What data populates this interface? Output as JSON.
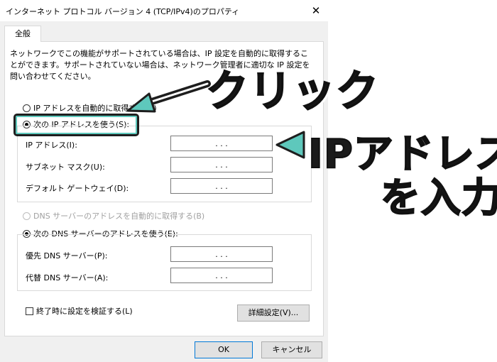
{
  "window": {
    "title": "インターネット プロトコル バージョン 4 (TCP/IPv4)のプロパティ",
    "close_glyph": "✕"
  },
  "tabs": [
    {
      "label": "全般"
    }
  ],
  "description": "ネットワークでこの機能がサポートされている場合は、IP 設定を自動的に取得することができます。サポートされていない場合は、ネットワーク管理者に適切な IP 設定を問い合わせてください。",
  "ip_section": {
    "auto_label": "IP アドレスを自動的に取得する(O)",
    "manual_label": "次の IP アドレスを使う(S):",
    "fields": [
      {
        "label": "IP アドレス(I):",
        "value": ". . ."
      },
      {
        "label": "サブネット マスク(U):",
        "value": ". . ."
      },
      {
        "label": "デフォルト ゲートウェイ(D):",
        "value": ". . ."
      }
    ]
  },
  "dns_section": {
    "auto_label": "DNS サーバーのアドレスを自動的に取得する(B)",
    "manual_label": "次の DNS サーバーのアドレスを使う(E):",
    "fields": [
      {
        "label": "優先 DNS サーバー(P):",
        "value": ". . ."
      },
      {
        "label": "代替 DNS サーバー(A):",
        "value": ". . ."
      }
    ]
  },
  "validate_label": "終了時に設定を検証する(L)",
  "advanced_label": "詳細設定(V)...",
  "ok_label": "OK",
  "cancel_label": "キャンセル",
  "annotations": {
    "click_text": "クリック",
    "ip_text_line1": "IPアドレス",
    "ip_text_line2": "を入力",
    "accent_color": "#5ec8bc"
  }
}
